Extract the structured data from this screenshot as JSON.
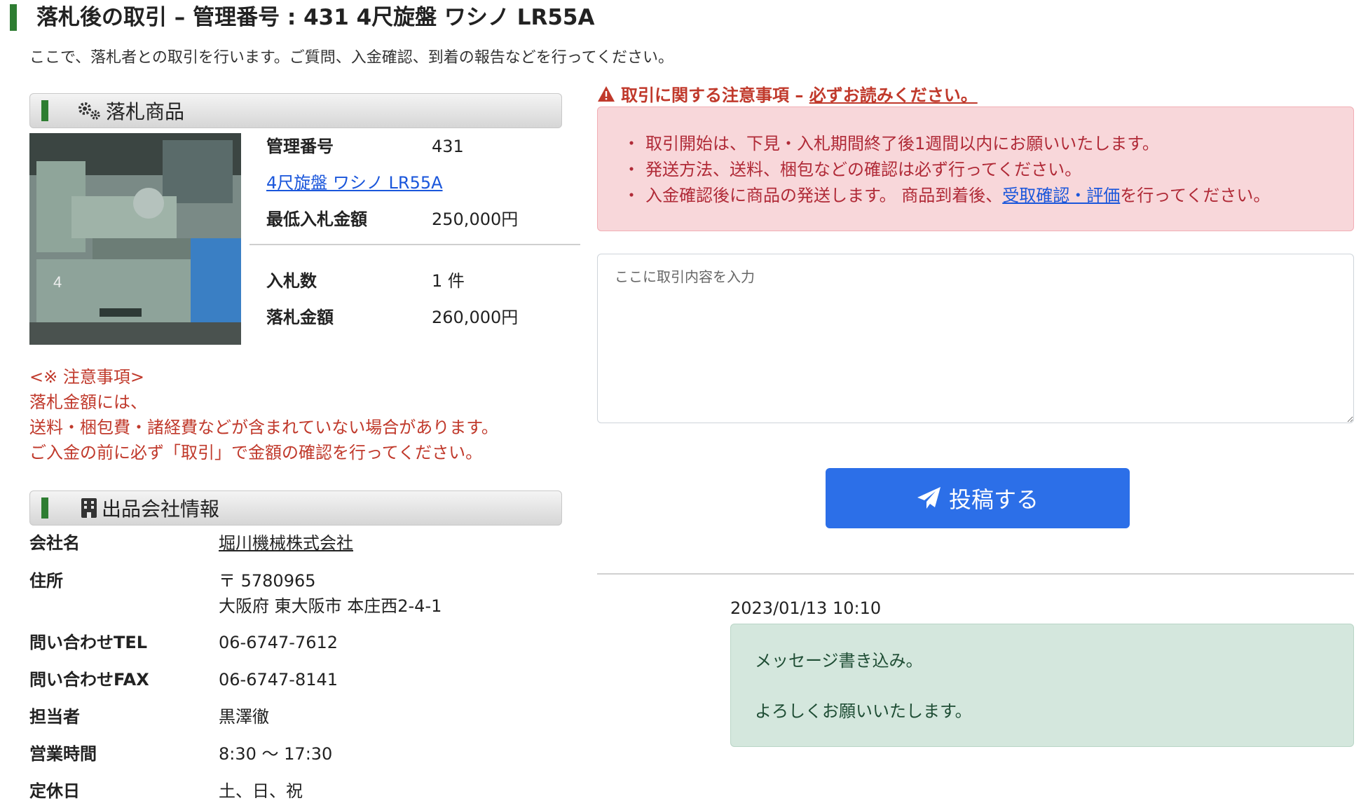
{
  "header": {
    "title": "落札後の取引 – 管理番号 : 431 4尺旋盤 ワシノ LR55A",
    "subtitle": "ここで、落札者との取引を行います。ご質問、入金確認、到着の報告などを行ってください。"
  },
  "product_section": {
    "heading": "落札商品",
    "icon": "gears-icon",
    "management_number_label": "管理番号",
    "management_number": "431",
    "product_name": "4尺旋盤 ワシノ LR55A",
    "min_bid_label": "最低入札金額",
    "min_bid": "250,000円",
    "bid_count_label": "入札数",
    "bid_count": "1 件",
    "winning_bid_label": "落札金額",
    "winning_bid": "260,000円"
  },
  "notes": {
    "heading": "<※ 注意事項>",
    "line1": "落札金額には、",
    "line2": "送料・梱包費・諸経費などが含まれていない場合があります。",
    "line3": "ご入金の前に必ず「取引」で金額の確認を行ってください。"
  },
  "company_section": {
    "heading": "出品会社情報",
    "icon": "building-icon",
    "name_label": "会社名",
    "name": "堀川機械株式会社",
    "address_label": "住所",
    "postal": "〒 5780965",
    "address": "大阪府 東大阪市 本庄西2-4-1",
    "tel_label": "問い合わせTEL",
    "tel": "06-6747-7612",
    "fax_label": "問い合わせFAX",
    "fax": "06-6747-8141",
    "contact_label": "担当者",
    "contact": "黒澤徹",
    "hours_label": "営業時間",
    "hours": "8:30 〜 17:30",
    "holiday_label": "定休日",
    "holiday": "土、日、祝"
  },
  "warning": {
    "title_prefix": "取引に関する注意事項 – ",
    "title_emph": "必ずお読みください。",
    "item1": "取引開始は、下見・入札期間終了後1週間以内にお願いいたします。",
    "item2": "発送方法、送料、梱包などの確認は必ず行ってください。",
    "item3_a": "入金確認後に商品の発送します。 商品到着後、",
    "item3_link": "受取確認・評価",
    "item3_b": "を行ってください。"
  },
  "form": {
    "placeholder": "ここに取引内容を入力",
    "submit_label": "投稿する"
  },
  "messages": [
    {
      "time": "2023/01/13 10:10",
      "line1": "メッセージ書き込み。",
      "line2": "よろしくお願いいたします。"
    }
  ],
  "colors": {
    "accent_green": "#2e7d32",
    "primary_blue": "#2c6fe8",
    "danger_red": "#c0392b"
  }
}
